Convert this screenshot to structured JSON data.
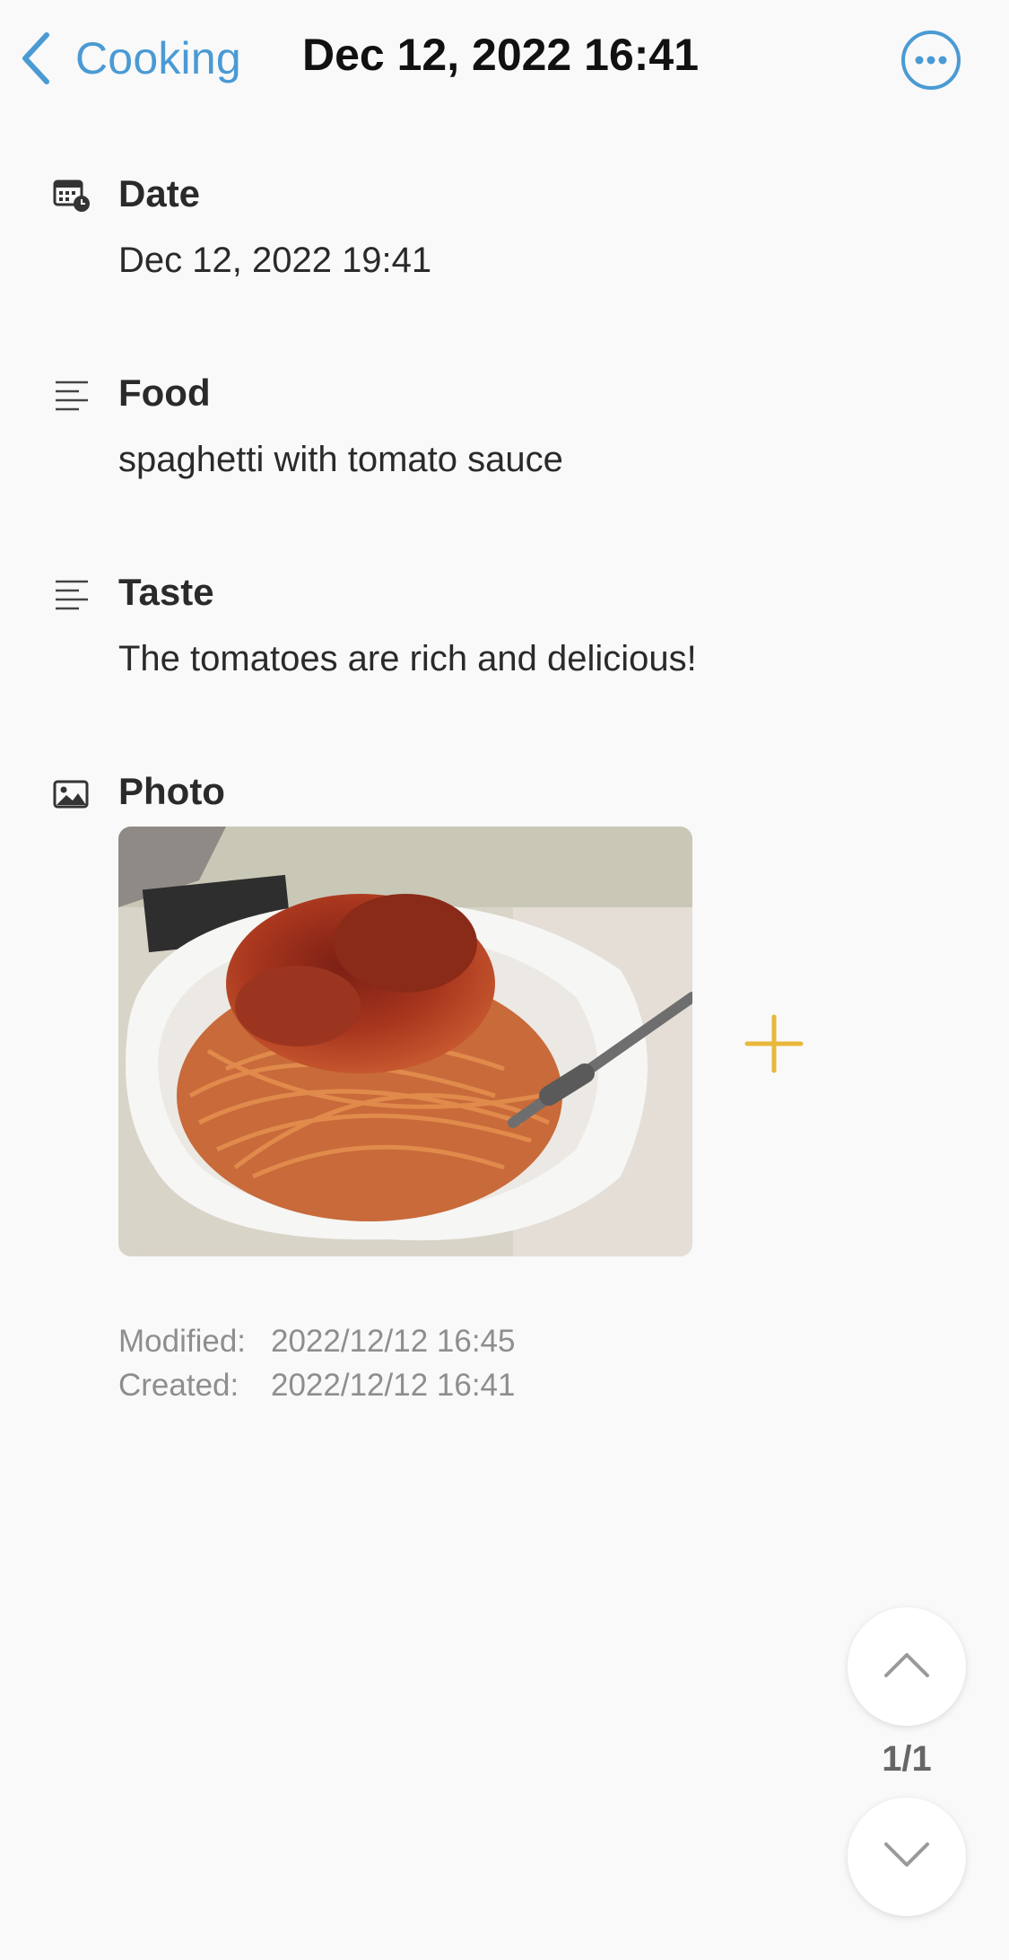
{
  "nav": {
    "back_label": "Cooking",
    "title": "Dec 12, 2022 16:41",
    "back_icon": "chevron-left-icon",
    "more_icon": "ellipsis-circle-icon"
  },
  "fields": [
    {
      "label": "Date",
      "value": "Dec 12, 2022 19:41",
      "icon": "calendar-clock-icon"
    },
    {
      "label": "Food",
      "value": "spaghetti with tomato sauce",
      "icon": "text-lines-icon"
    },
    {
      "label": "Taste",
      "value": "The tomatoes are rich and delicious!",
      "icon": "text-lines-icon"
    },
    {
      "label": "Photo",
      "icon": "image-icon"
    }
  ],
  "photo": {
    "add_icon": "plus-icon"
  },
  "meta": {
    "modified_label": "Modified:",
    "modified_value": "2022/12/12 16:45",
    "created_label": "Created:",
    "created_value": "2022/12/12 16:41"
  },
  "pager": {
    "text": "1/1",
    "up_icon": "chevron-up-icon",
    "down_icon": "chevron-down-icon"
  },
  "colors": {
    "accent": "#4a9ad4",
    "add": "#e8b83a",
    "background": "#f9f9f9"
  }
}
